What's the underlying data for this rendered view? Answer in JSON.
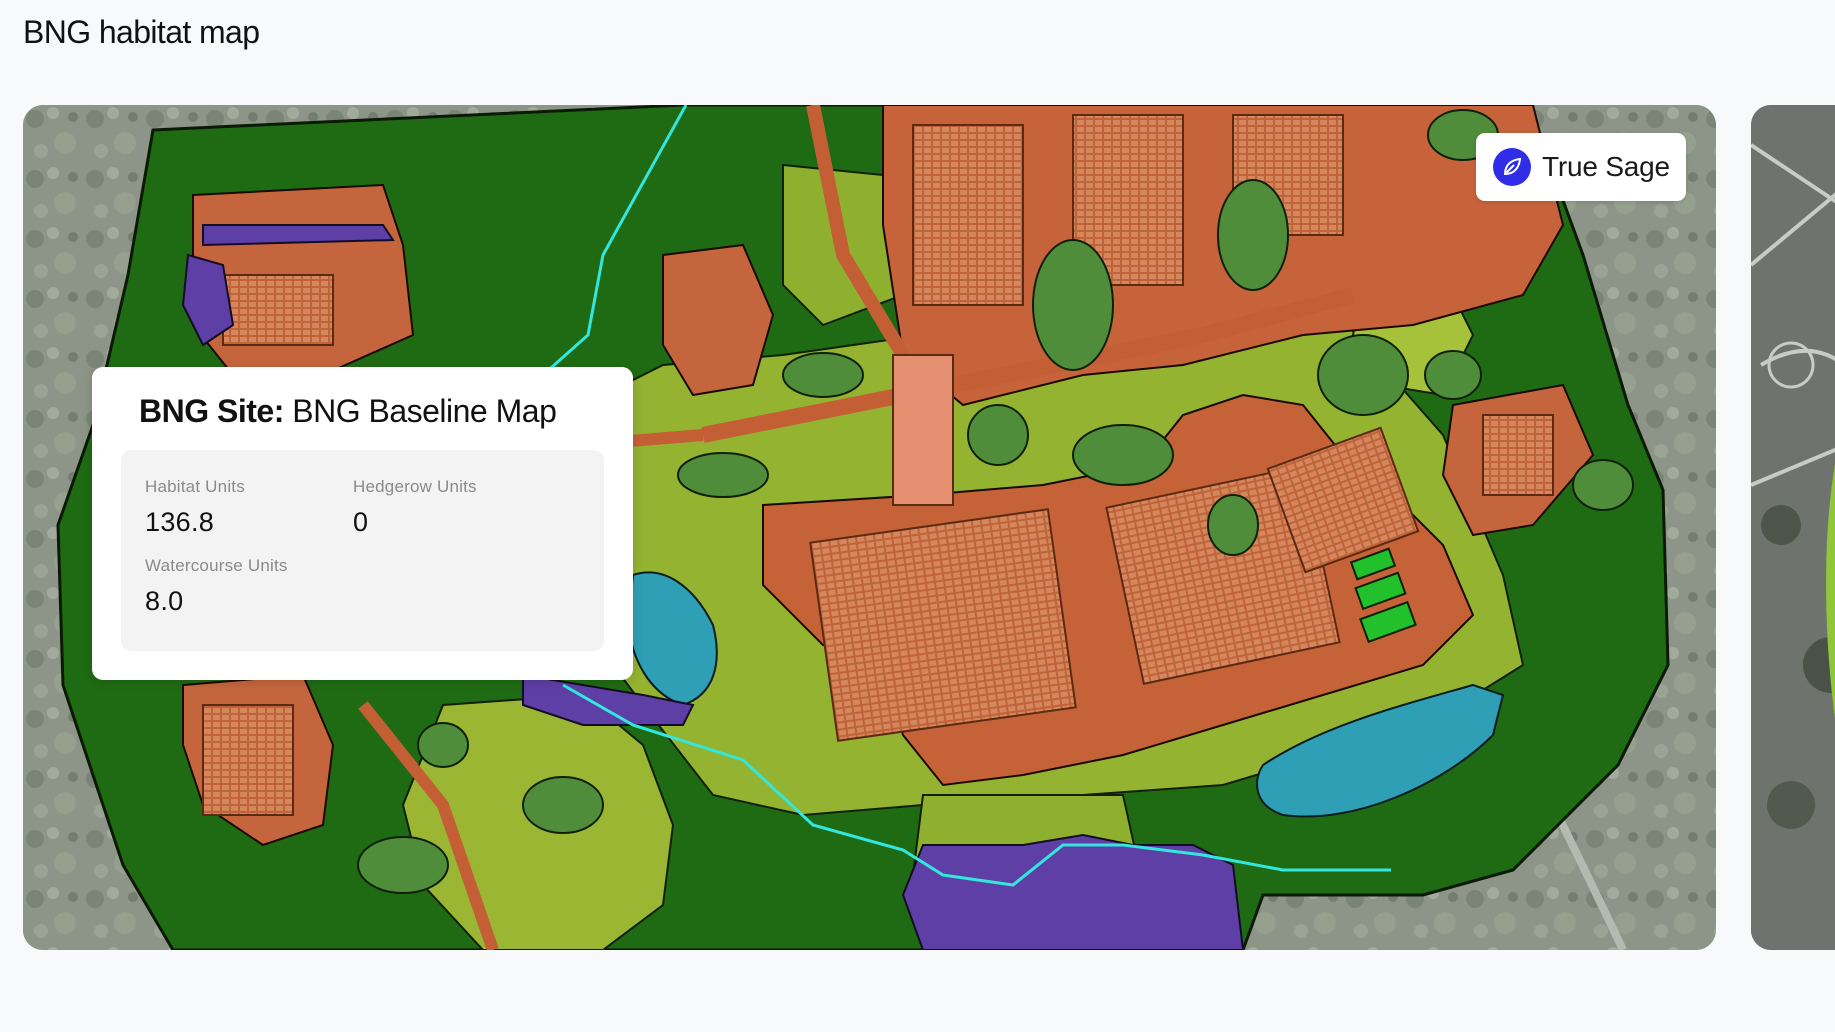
{
  "page": {
    "title": "BNG habitat map"
  },
  "brand": {
    "name": "True Sage",
    "logo_icon": "leaf-icon",
    "logo_color": "#2f2de8"
  },
  "site_panel": {
    "title_prefix": "BNG Site:",
    "title_name": "BNG Baseline Map",
    "stats": [
      {
        "label": "Habitat Units",
        "value": "136.8"
      },
      {
        "label": "Hedgerow Units",
        "value": "0"
      },
      {
        "label": "Watercourse Units",
        "value": "8.0"
      }
    ]
  },
  "map": {
    "habitat_colors": {
      "woodland": "#1f6b13",
      "grassland": "#8fb02e",
      "urban": "#c7623a",
      "water": "#2f9fb5",
      "wetland": "#5e3fa6",
      "watercourse": "#33e6de",
      "allotment": "#22c02a"
    }
  }
}
